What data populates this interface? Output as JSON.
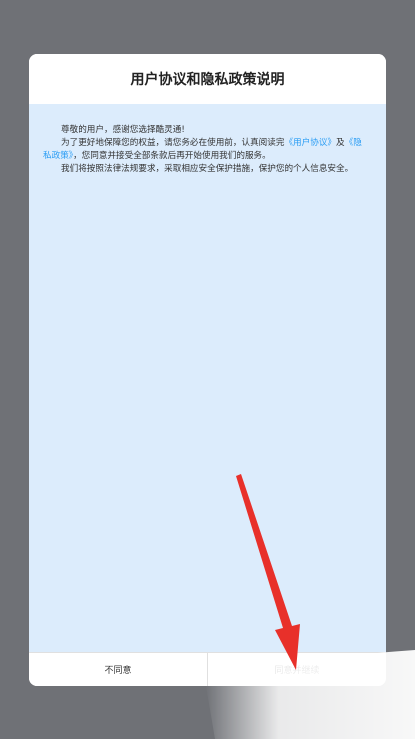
{
  "dialog": {
    "title": "用户协议和隐私政策说明",
    "greeting": "尊敬的用户，感谢您选择酷灵通!",
    "para1_pre": "为了更好地保障您的权益，请您务必在使用前，认真阅读完",
    "link_user_agreement": "《用户协议》",
    "para1_mid": "及",
    "link_privacy_policy": "《隐私政策》",
    "para1_post": "，您同意并接受全部条款后再开始使用我们的服务。",
    "para2": "我们将按照法律法规要求，采取相应安全保护措施，保护您的个人信息安全。",
    "disagree_label": "不同意",
    "agree_label": "同意并继续"
  },
  "colors": {
    "overlay": "#6f7176",
    "content_bg": "#dcecfc",
    "link": "#2a9df4",
    "arrow": "#e8302a"
  }
}
